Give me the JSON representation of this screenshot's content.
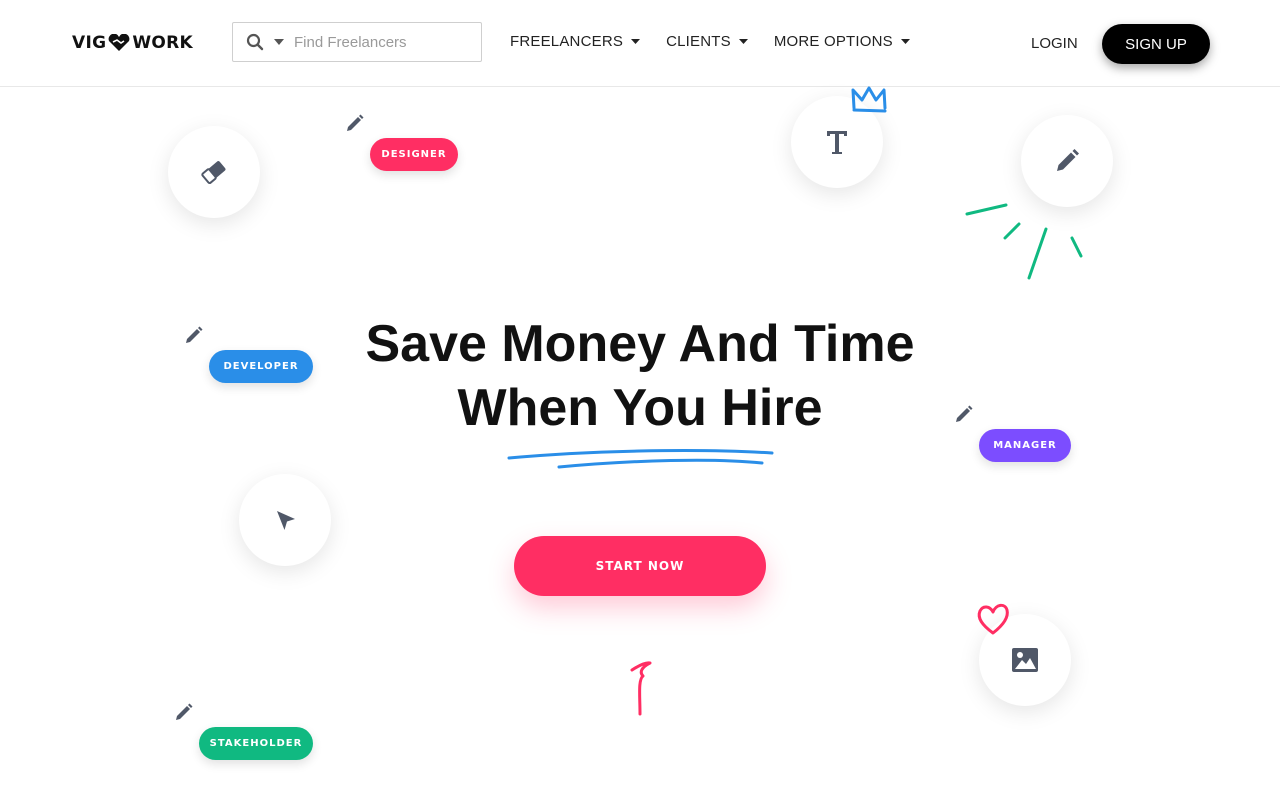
{
  "brand": {
    "logo_left": "VIG",
    "logo_right": "WORK"
  },
  "search": {
    "placeholder": "Find Freelancers"
  },
  "nav": {
    "items": [
      "FREELANCERS",
      "CLIENTS",
      "MORE OPTIONS"
    ]
  },
  "auth": {
    "login": "LOGIN",
    "signup": "SIGN UP"
  },
  "hero": {
    "line1": "Save Money And Time",
    "line2": "When You Hire",
    "cta": "START NOW"
  },
  "roles": {
    "designer": "DESIGNER",
    "developer": "DEVELOPER",
    "manager": "MANAGER",
    "stakeholder": "STAKEHOLDER"
  },
  "colors": {
    "accent_pink": "#ff2e63",
    "accent_blue": "#2a8ee8",
    "accent_purple": "#7c4dff",
    "accent_green": "#10b981",
    "icon_gray": "#505868"
  },
  "icons": [
    "search-icon",
    "eraser-icon",
    "text-icon",
    "pencil-icon",
    "cursor-icon",
    "image-icon",
    "crown-icon",
    "heart-icon"
  ]
}
